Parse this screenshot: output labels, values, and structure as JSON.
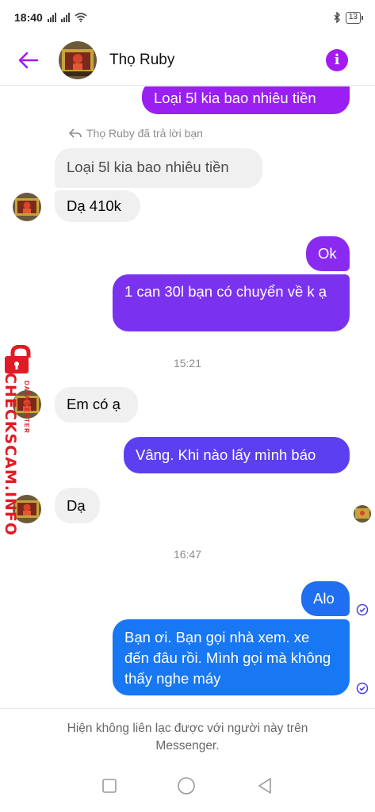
{
  "status": {
    "time": "18:40",
    "battery": "13"
  },
  "header": {
    "contact_name": "Thọ Ruby"
  },
  "messages": [
    {
      "id": "m1",
      "text": "Loại 5l kia bao nhiêu tiền",
      "dir": "out"
    },
    {
      "id": "reply",
      "text": "Thọ Ruby đã trả lời bạn"
    },
    {
      "id": "m2",
      "text": "Loại 5l kia bao nhiêu tiền",
      "dir": "in"
    },
    {
      "id": "m3",
      "text": "Dạ 410k",
      "dir": "in"
    },
    {
      "id": "m4",
      "text": "Ok",
      "dir": "out"
    },
    {
      "id": "m5",
      "text": "1 can 30l bạn có chuyển về k ạ",
      "dir": "out"
    },
    {
      "id": "t1",
      "text": "15:21"
    },
    {
      "id": "m6",
      "text": "Em có ạ",
      "dir": "in"
    },
    {
      "id": "m7",
      "text": "Vâng. Khi nào lấy mình báo",
      "dir": "out"
    },
    {
      "id": "m8",
      "text": "Dạ",
      "dir": "in"
    },
    {
      "id": "t2",
      "text": "16:47"
    },
    {
      "id": "m9",
      "text": "Alo",
      "dir": "out"
    },
    {
      "id": "m10",
      "text": "Bạn ơi. Bạn gọi nhà xem. xe đến đâu rồi. Mình gọi mà không thấy nghe máy",
      "dir": "out"
    }
  ],
  "watermark": {
    "brand": "CHECKSCAM.INFO",
    "tagline": "DATA CENTER"
  },
  "footer": {
    "note": "Hiện không liên lạc được với người này trên Messenger."
  },
  "colors": {
    "accent": "#a31bf0",
    "bubble_in": "#f0f0f0",
    "watermark": "#e01b24"
  },
  "icons": {
    "back": "arrow-left-icon",
    "info": "info-icon",
    "seen": "check-circle-icon"
  }
}
